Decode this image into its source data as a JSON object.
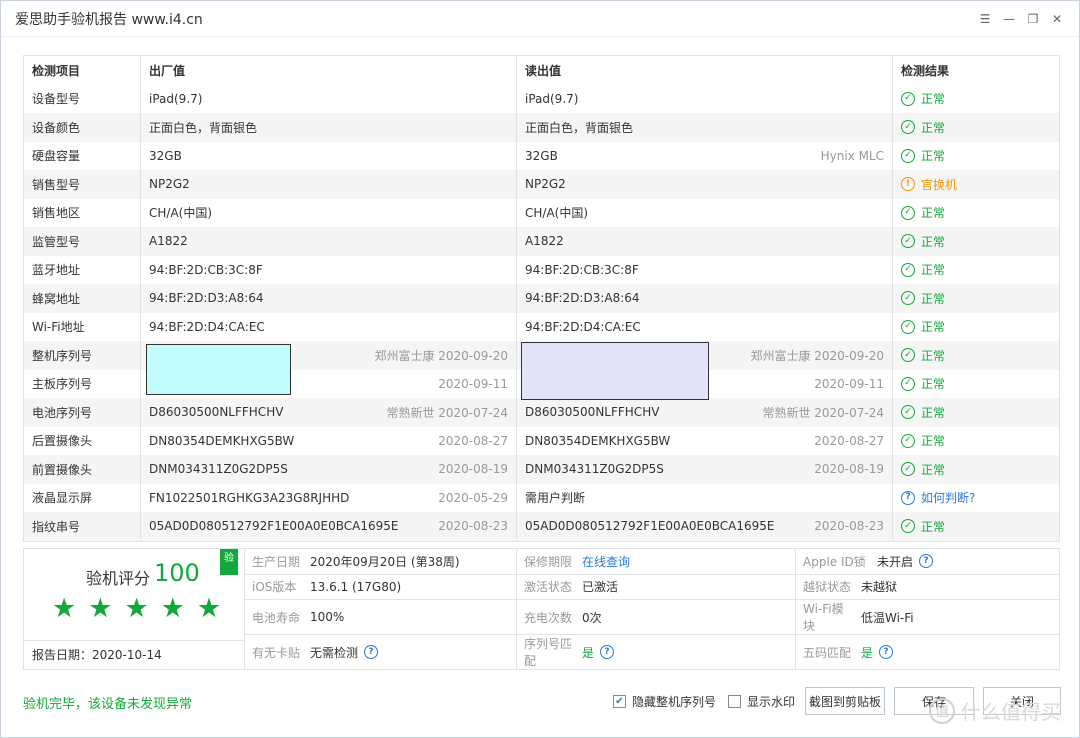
{
  "window": {
    "title": "爱思助手验机报告 www.i4.cn",
    "menu_icon": "list-icon",
    "minimize_icon": "minimize-icon",
    "restore_icon": "restore-icon",
    "close_icon": "close-icon"
  },
  "table": {
    "headers": {
      "item": "检测项目",
      "factory": "出厂值",
      "read": "读出值",
      "result": "检测结果"
    },
    "rows": [
      {
        "item": "设备型号",
        "factory": "iPad(9.7)",
        "factory_sub": "",
        "read": "iPad(9.7)",
        "read_sub": "",
        "result": "正常",
        "status": "ok"
      },
      {
        "item": "设备颜色",
        "factory": "正面白色，背面银色",
        "factory_sub": "",
        "read": "正面白色，背面银色",
        "read_sub": "",
        "result": "正常",
        "status": "ok"
      },
      {
        "item": "硬盘容量",
        "factory": "32GB",
        "factory_sub": "",
        "read": "32GB",
        "read_sub": "Hynix MLC",
        "result": "正常",
        "status": "ok"
      },
      {
        "item": "销售型号",
        "factory": "NP2G2",
        "factory_sub": "",
        "read": "NP2G2",
        "read_sub": "",
        "result": "官换机",
        "status": "warn"
      },
      {
        "item": "销售地区",
        "factory": "CH/A(中国)",
        "factory_sub": "",
        "read": "CH/A(中国)",
        "read_sub": "",
        "result": "正常",
        "status": "ok"
      },
      {
        "item": "监管型号",
        "factory": "A1822",
        "factory_sub": "",
        "read": "A1822",
        "read_sub": "",
        "result": "正常",
        "status": "ok"
      },
      {
        "item": "蓝牙地址",
        "factory": "94:BF:2D:CB:3C:8F",
        "factory_sub": "",
        "read": "94:BF:2D:CB:3C:8F",
        "read_sub": "",
        "result": "正常",
        "status": "ok"
      },
      {
        "item": "蜂窝地址",
        "factory": "94:BF:2D:D3:A8:64",
        "factory_sub": "",
        "read": "94:BF:2D:D3:A8:64",
        "read_sub": "",
        "result": "正常",
        "status": "ok"
      },
      {
        "item": "Wi-Fi地址",
        "factory": "94:BF:2D:D4:CA:EC",
        "factory_sub": "",
        "read": "94:BF:2D:D4:CA:EC",
        "read_sub": "",
        "result": "正常",
        "status": "ok"
      },
      {
        "item": "整机序列号",
        "factory": "",
        "factory_sub": "郑州富士康 2020-09-20",
        "read": "",
        "read_sub": "郑州富士康 2020-09-20",
        "result": "正常",
        "status": "ok"
      },
      {
        "item": "主板序列号",
        "factory": "",
        "factory_sub": "2020-09-11",
        "read": "",
        "read_sub": "2020-09-11",
        "result": "正常",
        "status": "ok"
      },
      {
        "item": "电池序列号",
        "factory": "D86030500NLFFHCHV",
        "factory_sub": "常熟新世 2020-07-24",
        "read": "D86030500NLFFHCHV",
        "read_sub": "常熟新世 2020-07-24",
        "result": "正常",
        "status": "ok"
      },
      {
        "item": "后置摄像头",
        "factory": "DN80354DEMKHXG5BW",
        "factory_sub": "2020-08-27",
        "read": "DN80354DEMKHXG5BW",
        "read_sub": "2020-08-27",
        "result": "正常",
        "status": "ok"
      },
      {
        "item": "前置摄像头",
        "factory": "DNM034311Z0G2DP5S",
        "factory_sub": "2020-08-19",
        "read": "DNM034311Z0G2DP5S",
        "read_sub": "2020-08-19",
        "result": "正常",
        "status": "ok"
      },
      {
        "item": "液晶显示屏",
        "factory": "FN1022501RGHKG3A23G8RJHHD",
        "factory_sub": "2020-05-29",
        "read": "需用户判断",
        "read_sub": "",
        "result": "如何判断?",
        "status": "help"
      },
      {
        "item": "指纹串号",
        "factory": "05AD0D080512792F1E00A0E0BCA1695E",
        "factory_sub": "2020-08-23",
        "read": "05AD0D080512792F1E00A0E0BCA1695E",
        "read_sub": "2020-08-23",
        "result": "正常",
        "status": "ok"
      }
    ]
  },
  "summary": {
    "score_label": "验机评分",
    "score": "100",
    "badge": "验",
    "stars": 5,
    "report_date": "报告日期：2020-10-14",
    "cells": [
      {
        "key": "生产日期",
        "value": "2020年09月20日 (第38周)",
        "style": "",
        "help": false
      },
      {
        "key": "保修期限",
        "value": "在线查询",
        "style": "link",
        "help": false
      },
      {
        "key": "Apple ID锁",
        "value": "未开启",
        "style": "",
        "help": true,
        "wide": true
      },
      {
        "key": "iOS版本",
        "value": "13.6.1 (17G80)",
        "style": "",
        "help": false
      },
      {
        "key": "激活状态",
        "value": "已激活",
        "style": "",
        "help": false
      },
      {
        "key": "越狱状态",
        "value": "未越狱",
        "style": "",
        "help": false
      },
      {
        "key": "电池寿命",
        "value": "100%",
        "style": "",
        "help": false
      },
      {
        "key": "充电次数",
        "value": "0次",
        "style": "",
        "help": false
      },
      {
        "key": "Wi-Fi模块",
        "value": "低温Wi-Fi",
        "style": "",
        "help": false
      },
      {
        "key": "有无卡贴",
        "value": "无需检测",
        "style": "",
        "help": true
      },
      {
        "key": "序列号匹配",
        "value": "是",
        "style": "green",
        "help": true
      },
      {
        "key": "五码匹配",
        "value": "是",
        "style": "green",
        "help": true
      }
    ]
  },
  "footer": {
    "status_text": "验机完毕，该设备未发现异常",
    "hide_serial_label": "隐藏整机序列号",
    "hide_serial_checked": true,
    "watermark_label": "显示水印",
    "watermark_checked": false,
    "copy_button": "截图到剪贴板",
    "save_button": "保存",
    "close_button": "关闭",
    "site_watermark": "什么值得买"
  },
  "colors": {
    "ok": "#14a83c",
    "warn": "#f39800",
    "help": "#2a7ad4"
  }
}
